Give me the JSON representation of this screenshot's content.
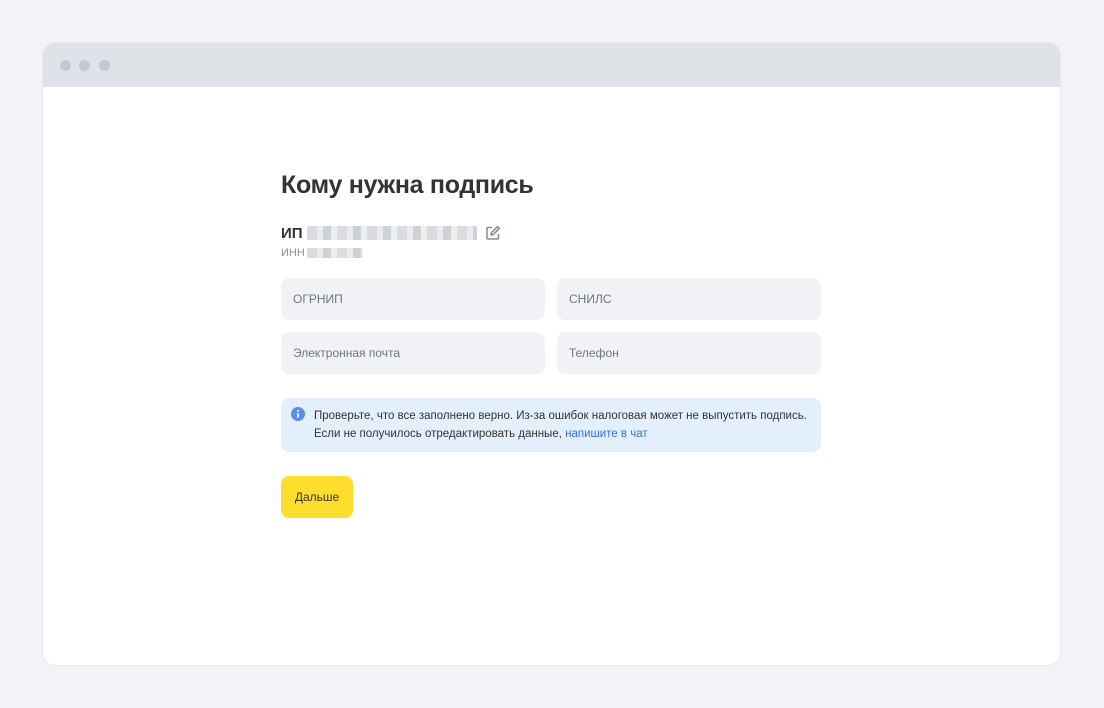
{
  "window": {
    "controls": [
      "close-dot",
      "minimize-dot",
      "maximize-dot"
    ]
  },
  "page": {
    "title": "Кому нужна подпись",
    "entity_type": "ИП",
    "inn_label": "ИНН"
  },
  "form": {
    "ogrnip_placeholder": "ОГРНИП",
    "snils_placeholder": "СНИЛС",
    "email_placeholder": "Электронная почта",
    "phone_placeholder": "Телефон"
  },
  "notice": {
    "line1": "Проверьте, что все заполнено верно. Из-за ошибок налоговая может не выпустить подпись.",
    "line2": "Если не получилось отредактировать данные, ",
    "link": "напишите в чат",
    "icon": "info-icon"
  },
  "actions": {
    "next_label": "Дальше"
  },
  "colors": {
    "background": "#f2f3f7",
    "titlebar": "#dfe2e7",
    "field": "#f1f2f6",
    "notice_bg": "#e4effc",
    "link": "#336fee",
    "primary_button": "#ffdd2d"
  }
}
